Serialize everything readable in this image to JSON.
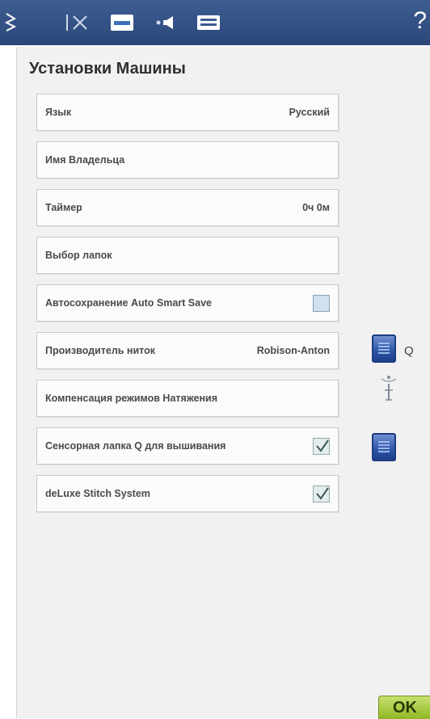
{
  "header": {
    "icons": [
      "stitch-icon",
      "settings-icon",
      "machine-settings-icon",
      "sound-icon",
      "embroidery-icon"
    ],
    "help_label": "?"
  },
  "page": {
    "title": "Установки Машины"
  },
  "settings": [
    {
      "label": "Язык",
      "value": "Русский"
    },
    {
      "label": "Имя Владельца"
    },
    {
      "label": "Таймер",
      "value": "0ч 0м"
    },
    {
      "label": "Выбор лапок"
    },
    {
      "label": "Автосохранение Auto Smart Save",
      "checked": false
    },
    {
      "label": "Производитель ниток",
      "value": "Robison-Anton"
    },
    {
      "label": "Компенсация режимов Натяжения"
    },
    {
      "label": "Сенсорная лапка Q для вышивания",
      "checked": true
    },
    {
      "label": "deLuxe Stitch System",
      "checked": true
    }
  ],
  "side": {
    "q_label": "Q"
  },
  "footer": {
    "ok_label": "OK"
  },
  "colors": {
    "header": "#2f4b7d",
    "panel": "#f1f1f1",
    "ok": "#a6c93c"
  }
}
